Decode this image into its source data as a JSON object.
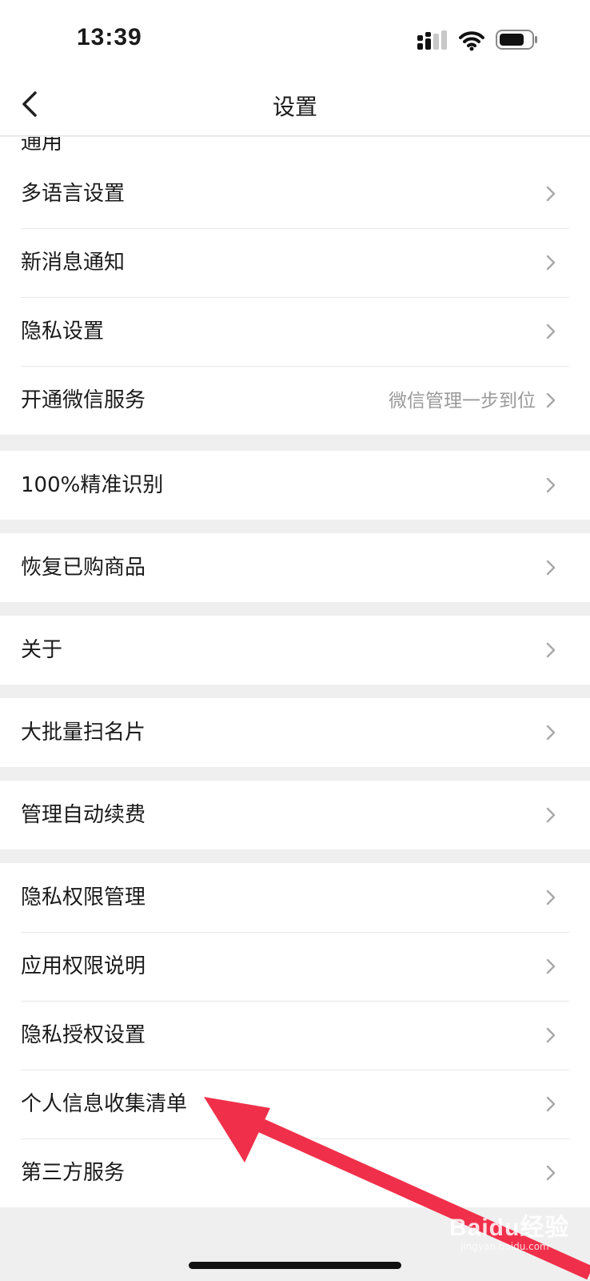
{
  "status": {
    "time": "13:39"
  },
  "nav": {
    "title": "设置"
  },
  "partial_item": {
    "label": "通用"
  },
  "groups": [
    {
      "items": [
        {
          "label": "多语言设置"
        },
        {
          "label": "新消息通知"
        },
        {
          "label": "隐私设置"
        },
        {
          "label": "开通微信服务",
          "hint": "微信管理一步到位"
        }
      ]
    },
    {
      "items": [
        {
          "label": "100%精准识别"
        }
      ]
    },
    {
      "items": [
        {
          "label": "恢复已购商品"
        }
      ]
    },
    {
      "items": [
        {
          "label": "关于"
        }
      ]
    },
    {
      "items": [
        {
          "label": "大批量扫名片"
        }
      ]
    },
    {
      "items": [
        {
          "label": "管理自动续费"
        }
      ]
    },
    {
      "items": [
        {
          "label": "隐私权限管理"
        },
        {
          "label": "应用权限说明"
        },
        {
          "label": "隐私授权设置"
        },
        {
          "label": "个人信息收集清单"
        },
        {
          "label": "第三方服务"
        }
      ]
    }
  ],
  "icons": {
    "back": "chevron-left-icon",
    "chevron": "chevron-right-icon",
    "signal": "signal-icon",
    "wifi": "wifi-icon",
    "battery": "battery-icon"
  },
  "colors": {
    "annotation_arrow": "#f0304a",
    "hint_text": "#9a9a9a",
    "background": "#efefef"
  },
  "watermark": {
    "brand": "Baidu经验",
    "url": "jingyan.baidu.com"
  }
}
